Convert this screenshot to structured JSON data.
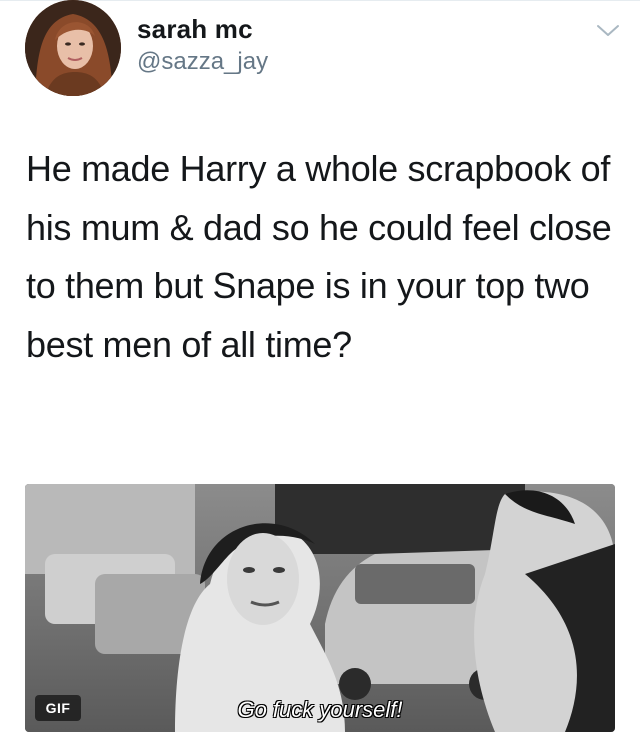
{
  "tweet": {
    "author_name": "sarah mc",
    "author_handle": "@sazza_jay",
    "text": "He made Harry a whole scrapbook of his mum & dad so he could feel close to them but Snape is in your top two best men of all time?"
  },
  "media": {
    "badge": "GIF",
    "caption": "Go fuck yourself!",
    "style": "grayscale"
  },
  "icons": {
    "menu": "chevron-down-icon"
  },
  "colors": {
    "text": "#14171a",
    "secondary": "#657786",
    "divider": "#e6ecf0"
  }
}
